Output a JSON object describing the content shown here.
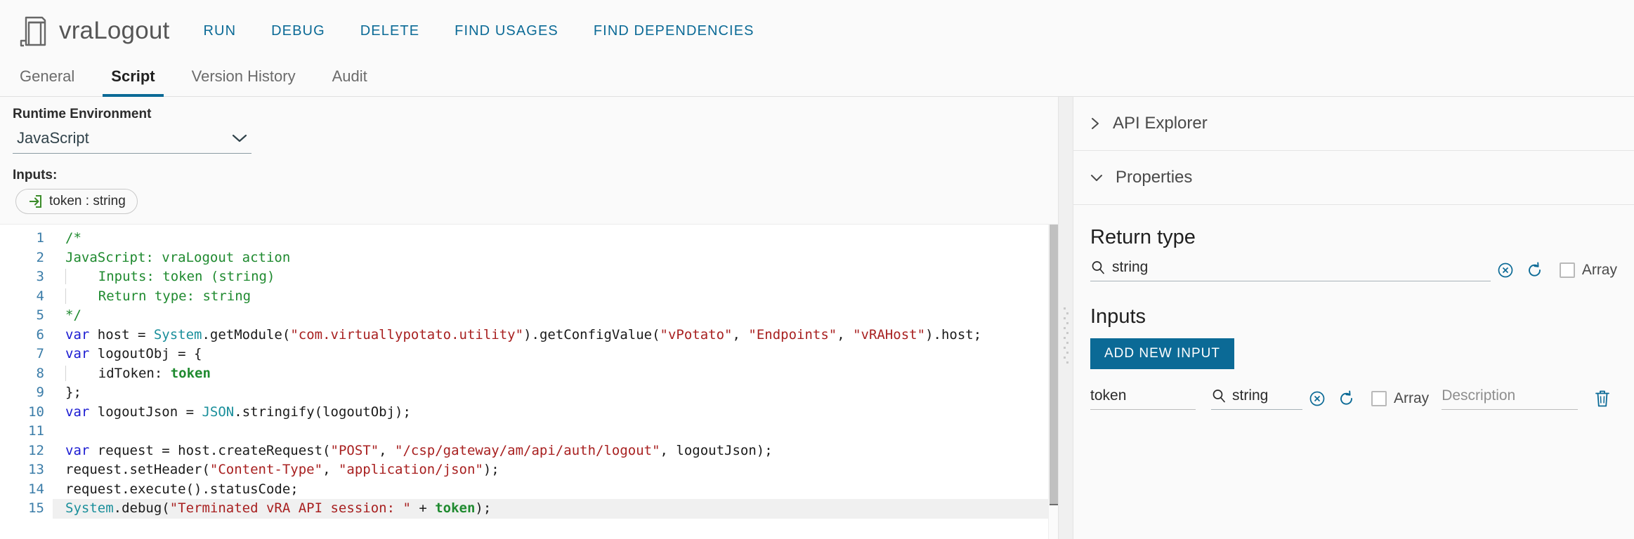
{
  "header": {
    "logo_icon": "script-action-icon",
    "title": "vraLogout",
    "toolbar": [
      {
        "label": "RUN",
        "name": "run-button"
      },
      {
        "label": "DEBUG",
        "name": "debug-button"
      },
      {
        "label": "DELETE",
        "name": "delete-button"
      },
      {
        "label": "FIND USAGES",
        "name": "find-usages-button"
      },
      {
        "label": "FIND DEPENDENCIES",
        "name": "find-dependencies-button"
      }
    ]
  },
  "tabs": [
    {
      "label": "General",
      "active": false
    },
    {
      "label": "Script",
      "active": true
    },
    {
      "label": "Version History",
      "active": false
    },
    {
      "label": "Audit",
      "active": false
    }
  ],
  "left": {
    "runtime_label": "Runtime Environment",
    "runtime_value": "JavaScript",
    "runtime_chevron_icon": "chevron-down-icon",
    "inputs_label": "Inputs:",
    "input_chip": {
      "icon": "input-arrow-icon",
      "label": "token : string"
    }
  },
  "code": {
    "lines": [
      {
        "n": "1",
        "segments": [
          {
            "t": "/*",
            "c": "cmt"
          }
        ]
      },
      {
        "n": "2",
        "segments": [
          {
            "t": "JavaScript: vraLogout action",
            "c": "cmt"
          }
        ]
      },
      {
        "n": "3",
        "segments": [
          {
            "t": "    Inputs: token (string)",
            "c": "cmt"
          }
        ],
        "guide": true
      },
      {
        "n": "4",
        "segments": [
          {
            "t": "    Return type: string",
            "c": "cmt"
          }
        ],
        "guide": true
      },
      {
        "n": "5",
        "segments": [
          {
            "t": "*/",
            "c": "cmt"
          }
        ]
      },
      {
        "n": "6",
        "segments": [
          {
            "t": "var",
            "c": "kw"
          },
          {
            "t": " host = ",
            "c": ""
          },
          {
            "t": "System",
            "c": "cls"
          },
          {
            "t": ".getModule(",
            "c": ""
          },
          {
            "t": "\"com.virtuallypotato.utility\"",
            "c": "str"
          },
          {
            "t": ").getConfigValue(",
            "c": ""
          },
          {
            "t": "\"vPotato\"",
            "c": "str"
          },
          {
            "t": ", ",
            "c": ""
          },
          {
            "t": "\"Endpoints\"",
            "c": "str"
          },
          {
            "t": ", ",
            "c": ""
          },
          {
            "t": "\"vRAHost\"",
            "c": "str"
          },
          {
            "t": ").host;",
            "c": ""
          }
        ]
      },
      {
        "n": "7",
        "segments": [
          {
            "t": "var",
            "c": "kw"
          },
          {
            "t": " logoutObj = {",
            "c": ""
          }
        ]
      },
      {
        "n": "8",
        "segments": [
          {
            "t": "    idToken: ",
            "c": ""
          },
          {
            "t": "token",
            "c": "var-bind"
          }
        ],
        "guide": true
      },
      {
        "n": "9",
        "segments": [
          {
            "t": "};",
            "c": ""
          }
        ]
      },
      {
        "n": "10",
        "segments": [
          {
            "t": "var",
            "c": "kw"
          },
          {
            "t": " logoutJson = ",
            "c": ""
          },
          {
            "t": "JSON",
            "c": "cls"
          },
          {
            "t": ".stringify(logoutObj);",
            "c": ""
          }
        ]
      },
      {
        "n": "11",
        "segments": [
          {
            "t": "",
            "c": ""
          }
        ]
      },
      {
        "n": "12",
        "segments": [
          {
            "t": "var",
            "c": "kw"
          },
          {
            "t": " request = host.createRequest(",
            "c": ""
          },
          {
            "t": "\"POST\"",
            "c": "str"
          },
          {
            "t": ", ",
            "c": ""
          },
          {
            "t": "\"/csp/gateway/am/api/auth/logout\"",
            "c": "str"
          },
          {
            "t": ", logoutJson);",
            "c": ""
          }
        ]
      },
      {
        "n": "13",
        "segments": [
          {
            "t": "request.setHeader(",
            "c": ""
          },
          {
            "t": "\"Content-Type\"",
            "c": "str"
          },
          {
            "t": ", ",
            "c": ""
          },
          {
            "t": "\"application/json\"",
            "c": "str"
          },
          {
            "t": ");",
            "c": ""
          }
        ]
      },
      {
        "n": "14",
        "segments": [
          {
            "t": "request.execute().statusCode;",
            "c": ""
          }
        ]
      },
      {
        "n": "15",
        "segments": [
          {
            "t": "System",
            "c": "cls"
          },
          {
            "t": ".debug(",
            "c": ""
          },
          {
            "t": "\"Terminated vRA API session: \"",
            "c": "str"
          },
          {
            "t": " + ",
            "c": ""
          },
          {
            "t": "token",
            "c": "var-bind"
          },
          {
            "t": ");",
            "c": ""
          }
        ],
        "current": true
      }
    ]
  },
  "right": {
    "api_explorer": {
      "label": "API Explorer",
      "chevron_icon": "chevron-right-icon",
      "expanded": false
    },
    "properties": {
      "label": "Properties",
      "chevron_icon": "chevron-down-icon",
      "expanded": true
    },
    "return_type": {
      "title": "Return type",
      "search_icon": "search-icon",
      "value": "string",
      "clear_icon": "clear-circle-icon",
      "refresh_icon": "refresh-icon",
      "array_label": "Array",
      "array_checked": false
    },
    "inputs": {
      "title": "Inputs",
      "add_button": "ADD NEW INPUT",
      "rows": [
        {
          "name": "token",
          "search_icon": "search-icon",
          "type": "string",
          "clear_icon": "clear-circle-icon",
          "refresh_icon": "refresh-icon",
          "array_label": "Array",
          "array_checked": false,
          "description_placeholder": "Description",
          "delete_icon": "trash-icon"
        }
      ]
    }
  },
  "colors": {
    "accent": "#0b6a96",
    "link": "#0b6a96",
    "comment_green": "#1f8a2f",
    "string_red": "#a82020",
    "keyword_blue": "#1b1bd2",
    "class_teal": "#1a8f9b"
  }
}
